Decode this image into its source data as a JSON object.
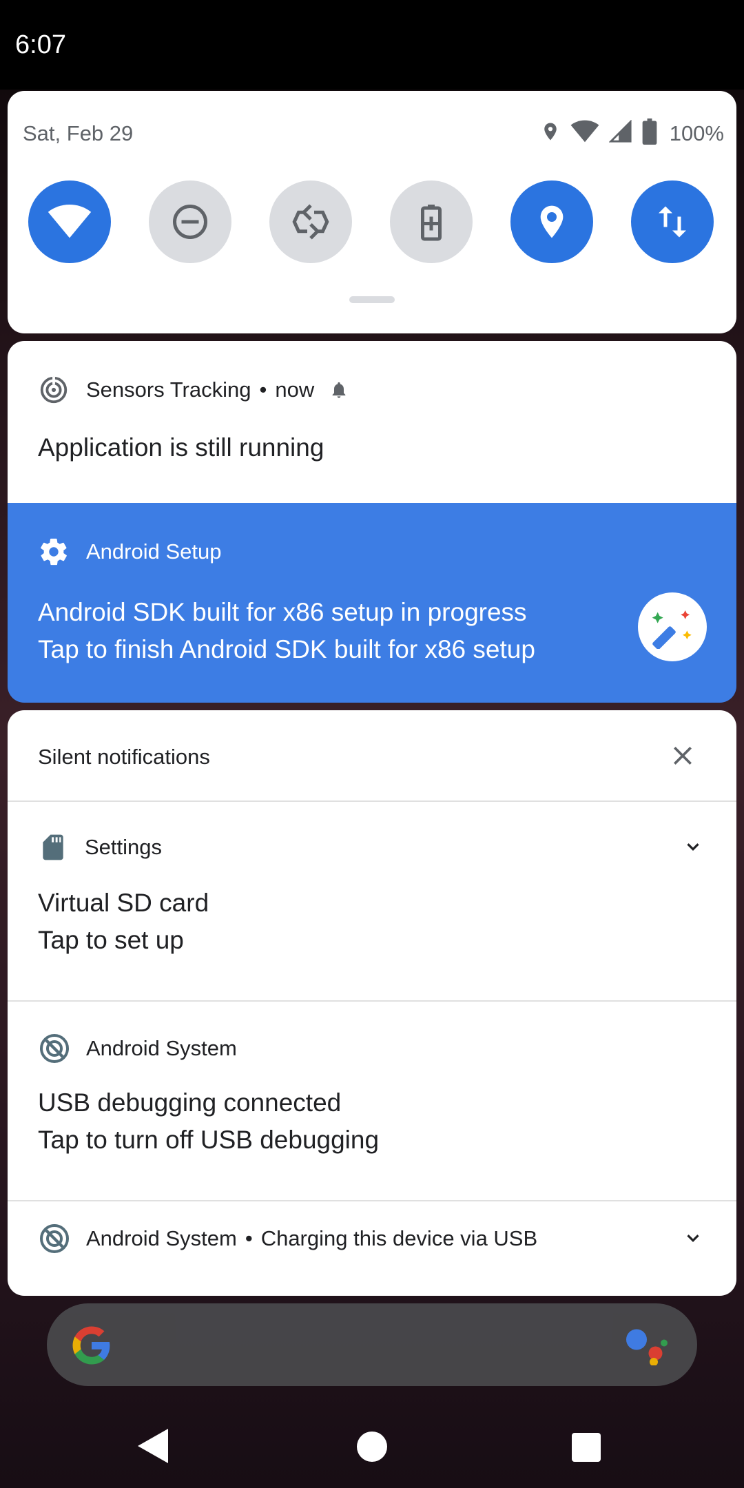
{
  "status_bar": {
    "time": "6:07"
  },
  "quick_settings": {
    "date": "Sat, Feb 29",
    "battery_percent": "100%",
    "tiles": [
      {
        "icon": "wifi-icon",
        "state": "on"
      },
      {
        "icon": "do-not-disturb-icon",
        "state": "off"
      },
      {
        "icon": "auto-rotate-icon",
        "state": "off"
      },
      {
        "icon": "battery-saver-icon",
        "state": "off"
      },
      {
        "icon": "location-icon",
        "state": "on"
      },
      {
        "icon": "mobile-data-icon",
        "state": "on"
      }
    ]
  },
  "notifications": {
    "sensors": {
      "app": "Sensors Tracking",
      "dot": "•",
      "time": "now",
      "text": "Application is still running"
    },
    "setup": {
      "app": "Android Setup",
      "title": "Android SDK built for x86 setup in progress",
      "text": "Tap to finish Android SDK built for x86 setup",
      "color": "#3d7de4"
    },
    "silent_header": "Silent notifications",
    "settings": {
      "app": "Settings",
      "title": "Virtual SD card",
      "text": "Tap to set up"
    },
    "usb_debug": {
      "app": "Android System",
      "title": "USB debugging connected",
      "text": "Tap to turn off USB debugging"
    },
    "charging": {
      "app": "Android System",
      "dot": "•",
      "text": "Charging this device via USB"
    }
  },
  "colors": {
    "accent": "#2b74e0",
    "tile_off": "#dadce0"
  }
}
